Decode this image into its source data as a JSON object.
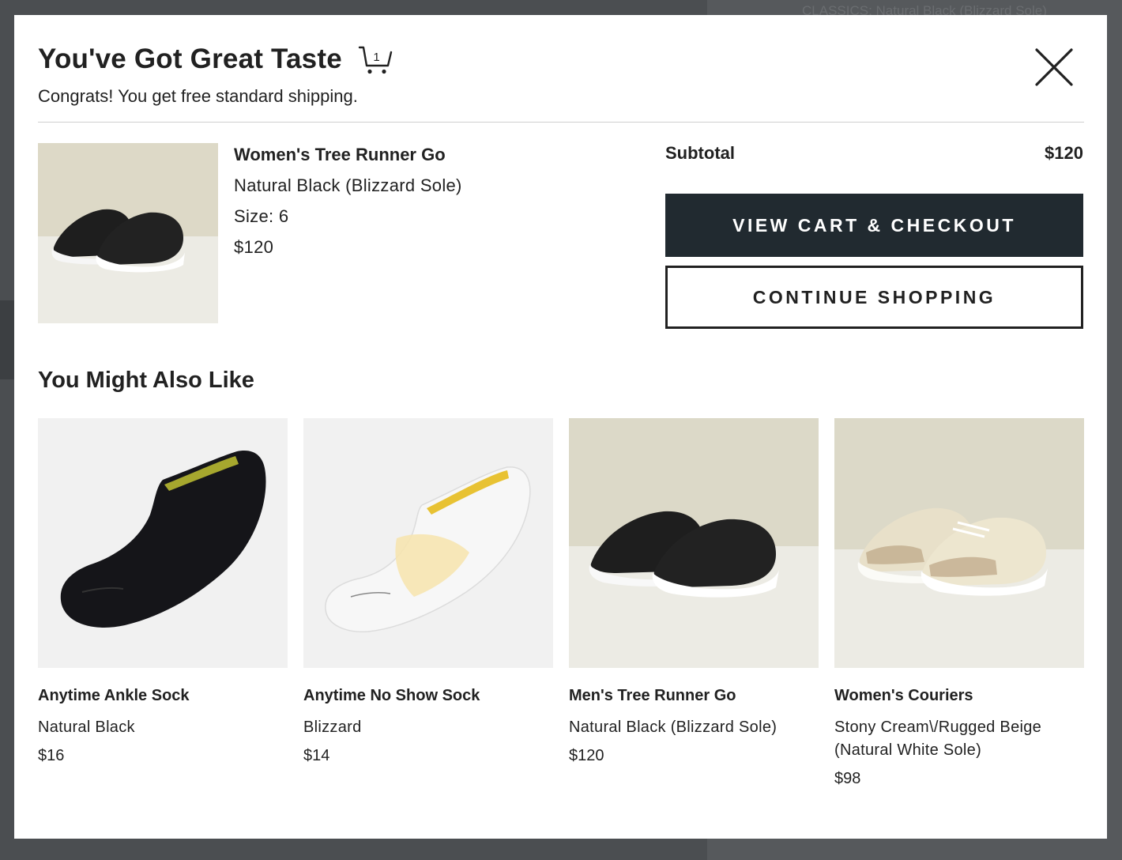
{
  "background": {
    "peek_text": "CLASSICS: Natural Black (Blizzard Sole)"
  },
  "modal": {
    "title": "You've Got Great Taste",
    "cart_count": "1",
    "subtitle": "Congrats! You get free standard shipping.",
    "close_icon": "close-icon"
  },
  "cart_item": {
    "name": "Women's Tree Runner Go",
    "color": "Natural Black (Blizzard Sole)",
    "size": "Size: 6",
    "price": "$120"
  },
  "summary": {
    "subtotal_label": "Subtotal",
    "subtotal_value": "$120",
    "checkout_label": "VIEW CART & CHECKOUT",
    "continue_label": "CONTINUE SHOPPING"
  },
  "recommendations": {
    "title": "You Might Also Like",
    "items": [
      {
        "name": "Anytime Ankle Sock",
        "color": "Natural Black",
        "price": "$16"
      },
      {
        "name": "Anytime No Show Sock",
        "color": "Blizzard",
        "price": "$14"
      },
      {
        "name": "Men's Tree Runner Go",
        "color": "Natural Black (Blizzard Sole)",
        "price": "$120"
      },
      {
        "name": "Women's Couriers",
        "color": "Stony Cream\\/Rugged Beige (Natural White Sole)",
        "price": "$98"
      }
    ]
  },
  "colors": {
    "primary_button": "#212a30",
    "text": "#212121",
    "overlay": "#4b4e51"
  }
}
